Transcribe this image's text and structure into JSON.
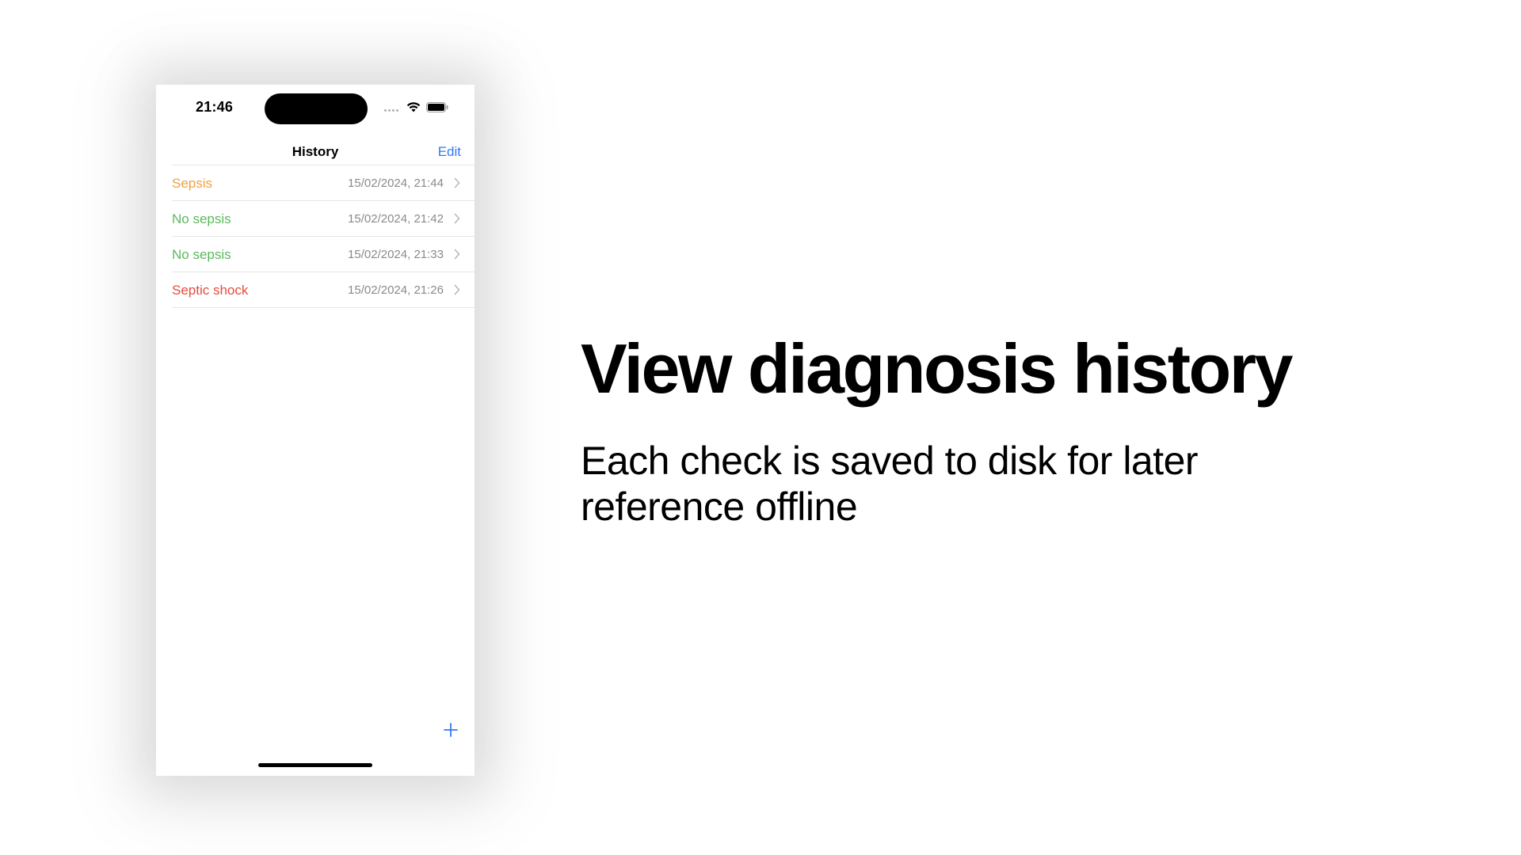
{
  "status_bar": {
    "time": "21:46",
    "icons": [
      "signal-dots-icon",
      "wifi-icon",
      "battery-icon"
    ]
  },
  "nav": {
    "title": "History",
    "edit_label": "Edit",
    "accent_color": "#3478f6"
  },
  "history": [
    {
      "label": "Sepsis",
      "date": "15/02/2024, 21:44",
      "color": "#f0a042"
    },
    {
      "label": "No sepsis",
      "date": "15/02/2024, 21:42",
      "color": "#5cb85c"
    },
    {
      "label": "No sepsis",
      "date": "15/02/2024, 21:33",
      "color": "#5cb85c"
    },
    {
      "label": "Septic shock",
      "date": "15/02/2024, 21:26",
      "color": "#e84a3c"
    }
  ],
  "toolbar": {
    "add_icon": "plus-icon"
  },
  "promo": {
    "headline": "View diagnosis history",
    "subtitle": "Each check is saved to disk for later reference offline"
  }
}
